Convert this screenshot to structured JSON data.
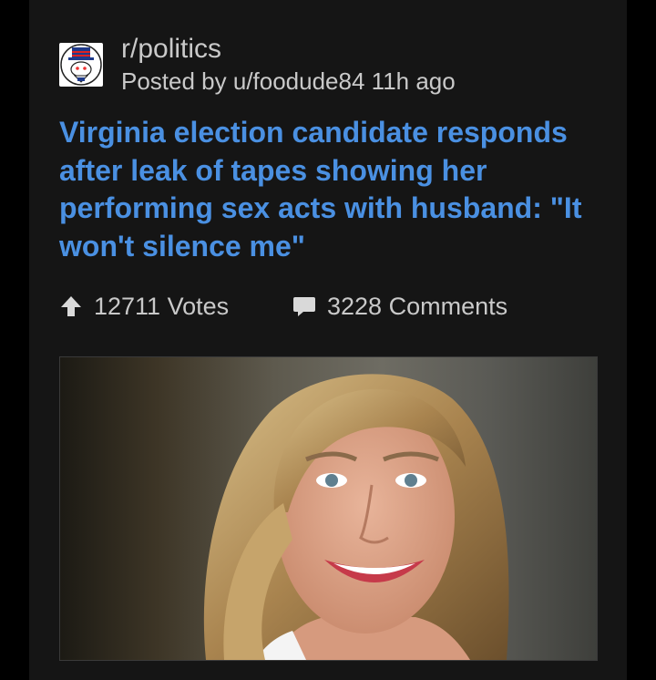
{
  "post": {
    "subreddit": "r/politics",
    "posted_by": "Posted by u/foodude84 11h ago",
    "title": "Virginia election candidate responds after leak of tapes showing her performing sex acts with husband: \"It won't silence me\"",
    "votes": "12711 Votes",
    "comments": "3228 Comments"
  },
  "icons": {
    "subreddit": "reddit-uncle-sam-snoo-icon",
    "upvote": "arrow-up-icon",
    "comment": "speech-bubble-icon"
  },
  "colors": {
    "title": "#4a90e2",
    "text": "#c9c9c9",
    "card": "#151515",
    "background": "#000000"
  }
}
